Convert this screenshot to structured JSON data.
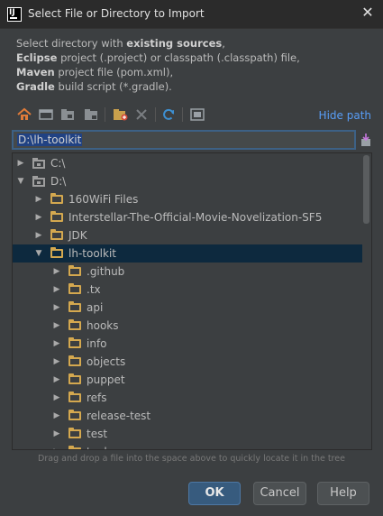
{
  "window": {
    "title": "Select File or Directory to Import",
    "icon_text": "IJ"
  },
  "description": {
    "line1_prefix": "Select directory with ",
    "line1_bold": "existing sources",
    "line1_suffix": ",",
    "line2_bold": "Eclipse",
    "line2_suffix": " project (.project) or classpath (.classpath) file,",
    "line3_bold": "Maven",
    "line3_suffix": " project file (pom.xml),",
    "line4_bold": "Gradle",
    "line4_suffix": " build script (*.gradle)."
  },
  "toolbar": {
    "hide_path_label": "Hide path",
    "icons": [
      "home-icon",
      "desktop-icon",
      "project-folder-icon",
      "module-folder-icon",
      "new-folder-icon",
      "delete-icon",
      "refresh-icon",
      "show-hidden-icon"
    ]
  },
  "path_field": {
    "value": "D:\\lh-toolkit"
  },
  "tree": {
    "rows": [
      {
        "label": "C:\\",
        "kind": "drive",
        "depth": 0,
        "expanded": false,
        "selected": false
      },
      {
        "label": "D:\\",
        "kind": "drive",
        "depth": 0,
        "expanded": true,
        "selected": false
      },
      {
        "label": "160WiFi Files",
        "kind": "folder",
        "depth": 1,
        "expanded": false,
        "selected": false
      },
      {
        "label": "Interstellar-The-Official-Movie-Novelization-SF5",
        "kind": "folder",
        "depth": 1,
        "expanded": false,
        "selected": false
      },
      {
        "label": "JDK",
        "kind": "folder",
        "depth": 1,
        "expanded": false,
        "selected": false
      },
      {
        "label": "lh-toolkit",
        "kind": "folder",
        "depth": 1,
        "expanded": true,
        "selected": true
      },
      {
        "label": ".github",
        "kind": "folder",
        "depth": 2,
        "expanded": false,
        "selected": false
      },
      {
        "label": ".tx",
        "kind": "folder",
        "depth": 2,
        "expanded": false,
        "selected": false
      },
      {
        "label": "api",
        "kind": "folder",
        "depth": 2,
        "expanded": false,
        "selected": false
      },
      {
        "label": "hooks",
        "kind": "folder",
        "depth": 2,
        "expanded": false,
        "selected": false
      },
      {
        "label": "info",
        "kind": "folder",
        "depth": 2,
        "expanded": false,
        "selected": false
      },
      {
        "label": "objects",
        "kind": "folder",
        "depth": 2,
        "expanded": false,
        "selected": false
      },
      {
        "label": "puppet",
        "kind": "folder",
        "depth": 2,
        "expanded": false,
        "selected": false
      },
      {
        "label": "refs",
        "kind": "folder",
        "depth": 2,
        "expanded": false,
        "selected": false
      },
      {
        "label": "release-test",
        "kind": "folder",
        "depth": 2,
        "expanded": false,
        "selected": false
      },
      {
        "label": "test",
        "kind": "folder",
        "depth": 2,
        "expanded": false,
        "selected": false
      },
      {
        "label": "tools",
        "kind": "folder",
        "depth": 2,
        "expanded": false,
        "selected": false
      }
    ]
  },
  "hint": "Drag and drop a file into the space above to quickly locate it in the tree",
  "buttons": {
    "ok": "OK",
    "cancel": "Cancel",
    "help": "Help"
  },
  "colors": {
    "background": "#3c3f41",
    "selection": "#0d293e",
    "folder": "#d4a84f",
    "link": "#589df6",
    "ok_button": "#375b7e"
  }
}
